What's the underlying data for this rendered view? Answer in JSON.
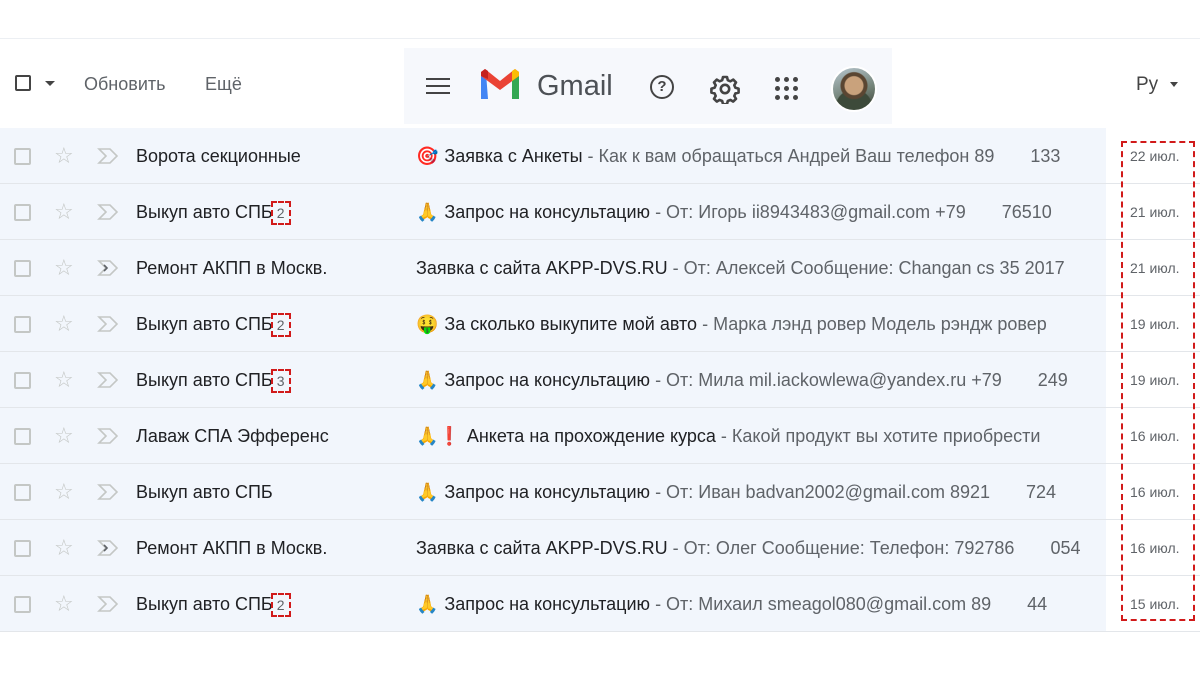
{
  "toolbar": {
    "refresh_label": "Обновить",
    "more_label": "Ещё"
  },
  "header": {
    "app_name": "Gmail",
    "help_icon": "help-icon",
    "settings_icon": "gear-icon",
    "apps_icon": "apps-grid-icon",
    "language": "Ру"
  },
  "colors": {
    "row_background": "#f2f6fc",
    "highlight": "#d11a1a",
    "brand_red": "#ea4335",
    "brand_blue": "#4285f4",
    "brand_green": "#34a853",
    "brand_yellow": "#fbbc04"
  },
  "emails": [
    {
      "sender": "Ворота секционные",
      "count": "",
      "emoji": "🎯",
      "emoji_class": "target",
      "subject": "Заявка с Анкеты",
      "snippet": " - Как к вам обращаться Андрей Ваш телефон 89",
      "snippet_tail": "133",
      "date": "22 июл.",
      "forwarded": false
    },
    {
      "sender": "Выкуп авто СПБ",
      "count": "2",
      "emoji": "🙏",
      "emoji_class": "pray",
      "subject": "Запрос на консультацию",
      "snippet": " - От: Игорь ii8943483@gmail.com +79",
      "snippet_tail": "76510",
      "date": "21 июл.",
      "forwarded": false
    },
    {
      "sender": "Ремонт АКПП в Москв.",
      "count": "",
      "emoji": "",
      "emoji_class": "",
      "subject": "Заявка с сайта AKPP-DVS.RU",
      "snippet": " - От: Алексей Сообщение: Changan cs 35 2017",
      "snippet_tail": "",
      "date": "21 июл.",
      "forwarded": true
    },
    {
      "sender": "Выкуп авто СПБ",
      "count": "2",
      "emoji": "🤑",
      "emoji_class": "money",
      "subject": "За сколько выкупите мой авто",
      "snippet": " - Марка лэнд ровер Модель рэндж ровер",
      "snippet_tail": "",
      "date": "19 июл.",
      "forwarded": false
    },
    {
      "sender": "Выкуп авто СПБ",
      "count": "3",
      "emoji": "🙏",
      "emoji_class": "pray",
      "subject": "Запрос на консультацию",
      "snippet": " - От: Мила mil.iackowlewa@yandex.ru +79",
      "snippet_tail": "249",
      "date": "19 июл.",
      "forwarded": false
    },
    {
      "sender": "Лаваж СПА Эфференс",
      "count": "",
      "emoji": "🙏❗",
      "emoji_class": "pray",
      "subject": "Анкета на прохождение курса",
      "snippet": " - Какой продукт вы хотите приобрести",
      "snippet_tail": "",
      "date": "16 июл.",
      "forwarded": false
    },
    {
      "sender": "Выкуп авто СПБ",
      "count": "",
      "emoji": "🙏",
      "emoji_class": "pray",
      "subject": "Запрос на консультацию",
      "snippet": " - От: Иван badvan2002@gmail.com 8921",
      "snippet_tail": "724",
      "date": "16 июл.",
      "forwarded": false
    },
    {
      "sender": "Ремонт АКПП в Москв.",
      "count": "",
      "emoji": "",
      "emoji_class": "",
      "subject": "Заявка с сайта AKPP-DVS.RU",
      "snippet": " - От: Олег Сообщение: Телефон: 792786",
      "snippet_tail": "054",
      "date": "16 июл.",
      "forwarded": true
    },
    {
      "sender": "Выкуп авто СПБ",
      "count": "2",
      "emoji": "🙏",
      "emoji_class": "pray",
      "subject": "Запрос на консультацию",
      "snippet": " - От: Михаил smeagol080@gmail.com 89",
      "snippet_tail": "44",
      "date": "15 июл.",
      "forwarded": false
    }
  ]
}
